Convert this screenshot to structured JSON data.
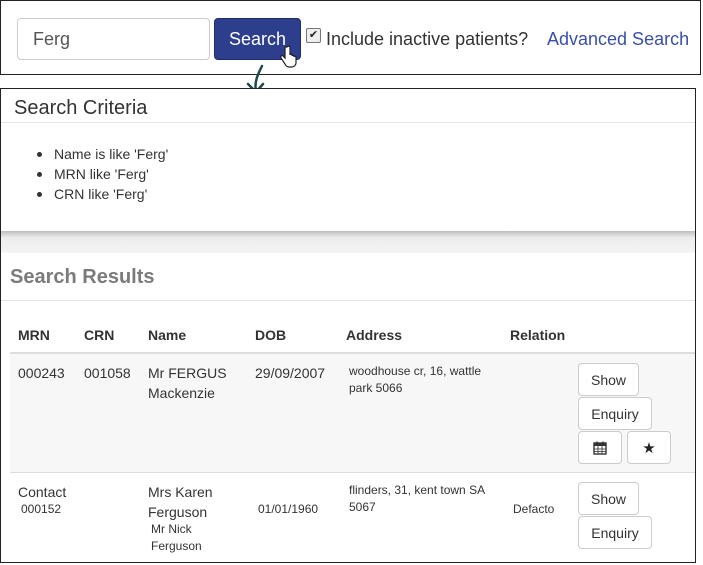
{
  "search": {
    "value": "Ferg",
    "button_label": "Search"
  },
  "include_inactive": {
    "label": "Include inactive patients?",
    "checked": true
  },
  "advanced_search_label": "Advanced Search",
  "criteria": {
    "title": "Search Criteria",
    "items": [
      "Name is like 'Ferg'",
      "MRN like 'Ferg'",
      "CRN like 'Ferg'"
    ]
  },
  "results": {
    "title": "Search Results",
    "columns": [
      "MRN",
      "CRN",
      "Name",
      "DOB",
      "Address",
      "Relation"
    ],
    "rows": [
      {
        "mrn": "000243",
        "crn": "001058",
        "name_line1": "Mr FERGUS",
        "name_line2": "Mackenzie",
        "dob": "29/09/2007",
        "address_line1": "woodhouse cr, 16, wattle",
        "address_line2": "park 5066",
        "relation": "",
        "buttons": {
          "show": "Show",
          "enquiry": "Enquiry",
          "calendar_icon": "calendar-icon",
          "star_icon": "star-icon"
        }
      },
      {
        "mrn_label": "Contact",
        "mrn": "000152",
        "crn": "",
        "name_line1": "Mrs Karen",
        "name_line2": "Ferguson",
        "contact_name_line1": "Mr Nick",
        "contact_name_line2": "Ferguson",
        "dob": "01/01/1960",
        "address_line1": "flinders, 31, kent town SA",
        "address_line2": "5067",
        "relation": "Defacto",
        "buttons": {
          "show": "Show",
          "enquiry": "Enquiry"
        }
      }
    ]
  },
  "colors": {
    "primary_button": "#2c3e8c",
    "link": "#3a4fa8",
    "results_title": "#7b7b7b",
    "row_highlight": "#f7f7f7"
  }
}
